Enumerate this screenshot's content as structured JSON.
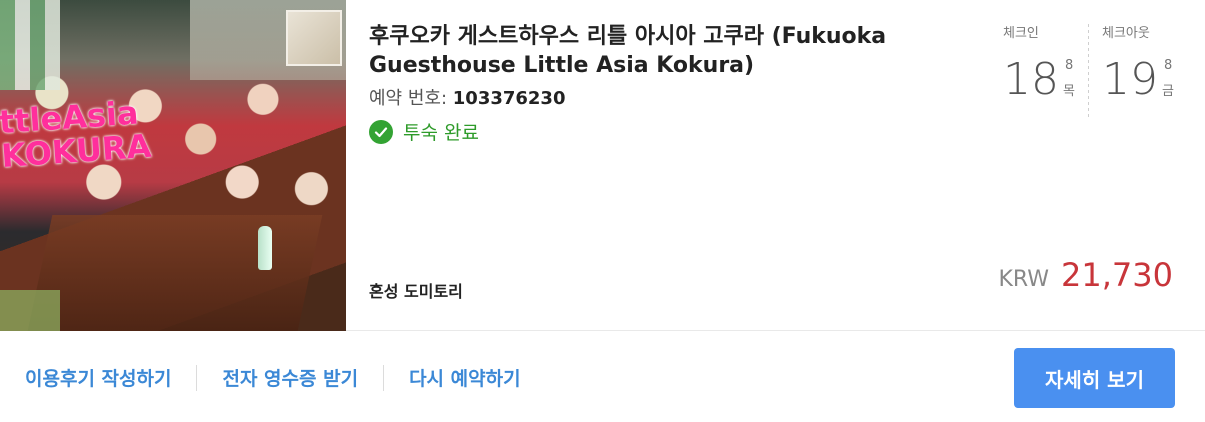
{
  "listing": {
    "title": "후쿠오카 게스트하우스 리틀 아시아 고쿠라 (Fukuoka Guesthouse Little Asia Kokura)",
    "booking_label": "예약 번호:",
    "booking_number": "103376230",
    "status": "투숙 완료",
    "room_type": "혼성 도미토리",
    "photo_text_line1": "ttleAsia",
    "photo_text_line2": "KOKURA"
  },
  "dates": {
    "checkin": {
      "label": "체크인",
      "day": "18",
      "month": "8",
      "weekday": "목"
    },
    "checkout": {
      "label": "체크아웃",
      "day": "19",
      "month": "8",
      "weekday": "금"
    }
  },
  "price": {
    "currency": "KRW",
    "amount": "21,730"
  },
  "actions": {
    "write_review": "이용후기 작성하기",
    "receipt": "전자 영수증 받기",
    "rebook": "다시 예약하기",
    "details": "자세히 보기"
  },
  "colors": {
    "accent": "#4a90f0",
    "link": "#3b88d6",
    "price": "#c8353a",
    "status": "#2e9b2a"
  },
  "icons": {
    "status": "check-circle-icon"
  }
}
